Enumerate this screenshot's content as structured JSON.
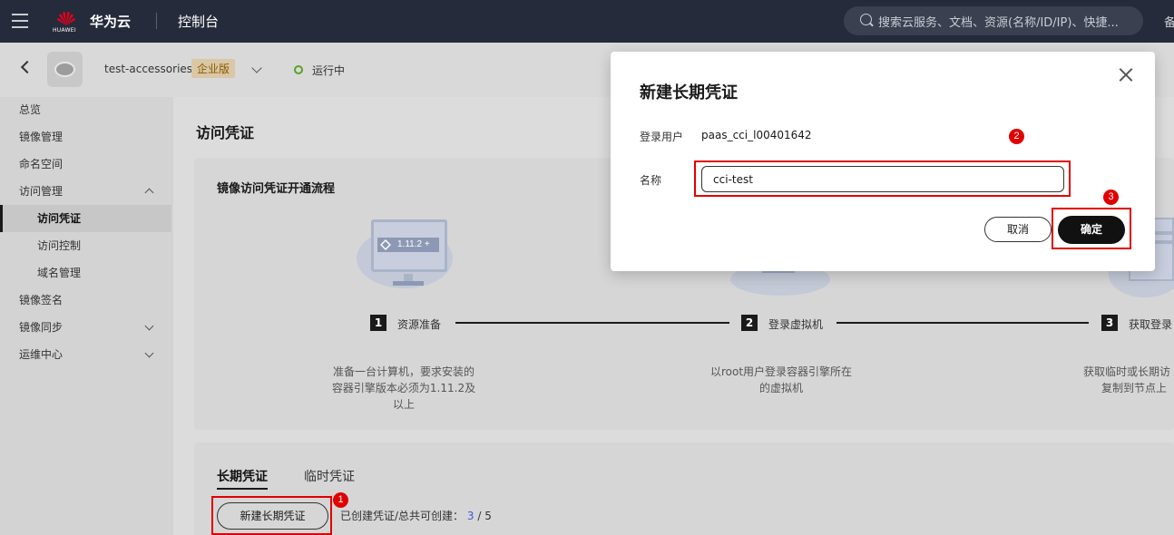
{
  "topbar": {
    "logo_text": "HUAWEI",
    "brand": "华为云",
    "console": "控制台",
    "search_placeholder": "搜索云服务、文档、资源(名称/ID/IP)、快捷...",
    "more": "备"
  },
  "instance": {
    "name": "test-accessories",
    "edition": "企业版",
    "status": "运行中",
    "status_color": "#5aa02c"
  },
  "sidebar": {
    "items": [
      {
        "label": "总览"
      },
      {
        "label": "镜像管理"
      },
      {
        "label": "命名空间"
      },
      {
        "label": "访问管理"
      },
      {
        "label": "访问凭证"
      },
      {
        "label": "访问控制"
      },
      {
        "label": "域名管理"
      },
      {
        "label": "镜像签名"
      },
      {
        "label": "镜像同步"
      },
      {
        "label": "运维中心"
      }
    ]
  },
  "main": {
    "page_title": "访问凭证",
    "flow_title": "镜像访问凭证开通流程",
    "version_badge": "1.11.2 +",
    "steps": [
      {
        "num": "1",
        "label": "资源准备",
        "desc_lines": [
          "准备一台计算机，要求安装的",
          "容器引擎版本必须为1.11.2及",
          "以上"
        ]
      },
      {
        "num": "2",
        "label": "登录虚拟机",
        "desc_lines": [
          "以root用户登录容器引擎所在",
          "的虚拟机"
        ]
      },
      {
        "num": "3",
        "label": "获取登录",
        "desc_lines": [
          "获取临时或长期访",
          "复制到节点上"
        ]
      }
    ],
    "tabs": [
      {
        "label": "长期凭证"
      },
      {
        "label": "临时凭证"
      }
    ],
    "create_button": "新建长期凭证",
    "quota_label": "已创建凭证/总共可创建：",
    "quota_current": "3",
    "quota_sep": " / ",
    "quota_total": "5"
  },
  "dialog": {
    "title": "新建长期凭证",
    "user_label": "登录用户",
    "user_value": "paas_cci_l00401642",
    "name_label": "名称",
    "name_value": "cci-test",
    "cancel": "取消",
    "confirm": "确定"
  },
  "annotations": {
    "badges": [
      "1",
      "2",
      "3"
    ],
    "highlight_color": "#e00000"
  }
}
